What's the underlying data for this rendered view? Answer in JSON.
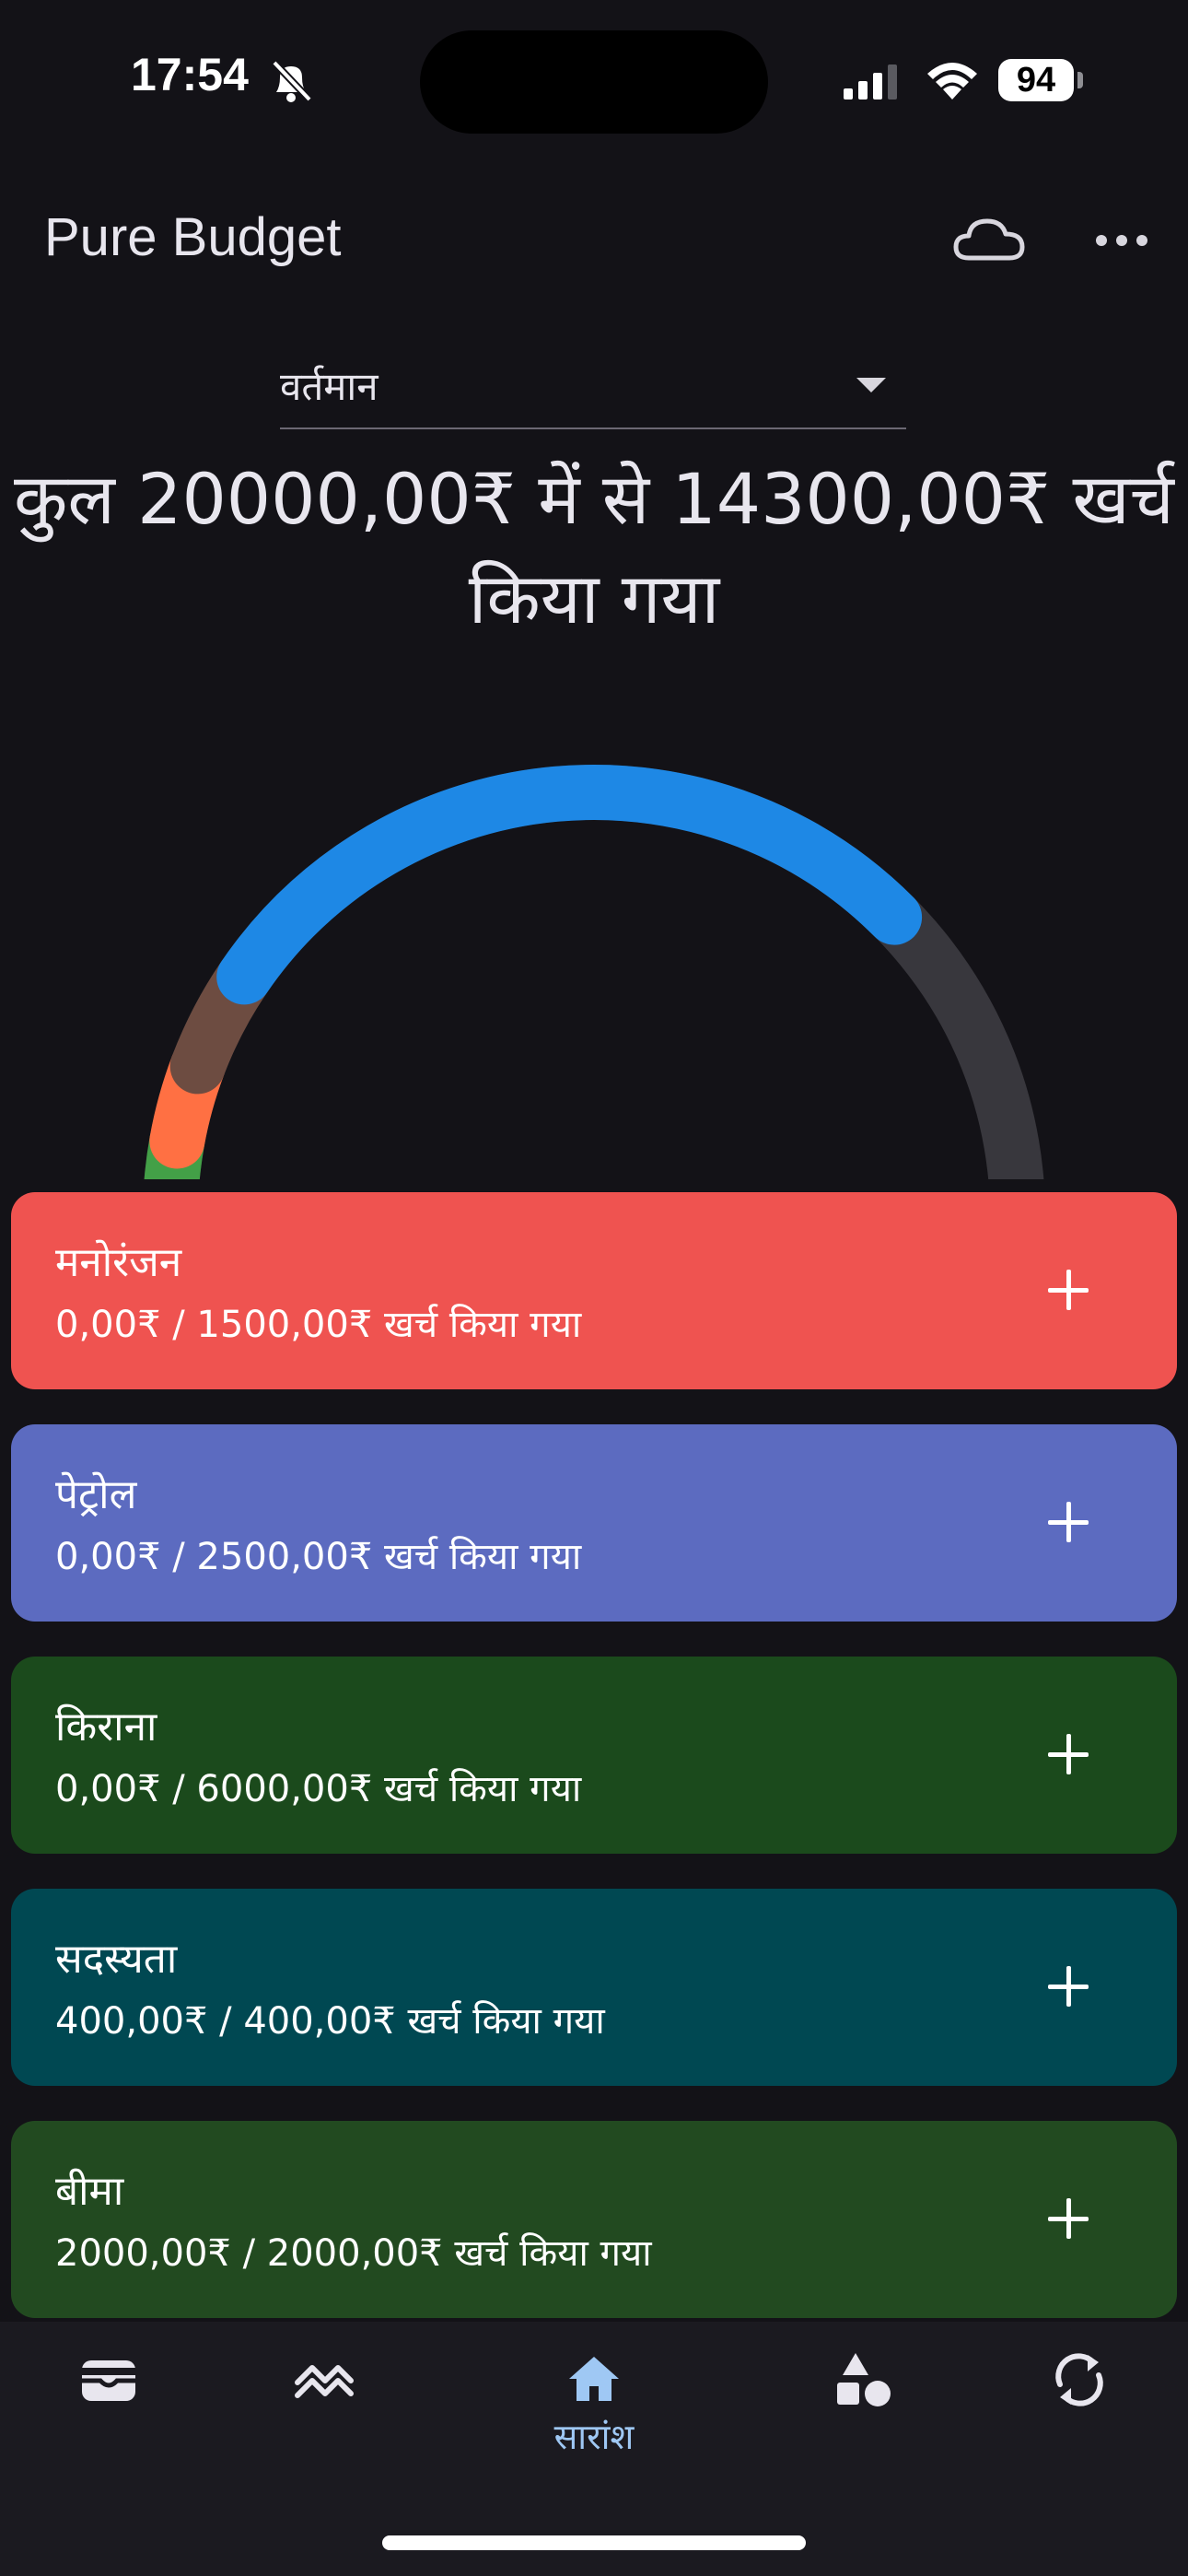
{
  "status_bar": {
    "time": "17:54",
    "battery": "94",
    "icons": [
      "bell-slash-icon",
      "signal-icon",
      "wifi-icon",
      "battery-icon"
    ]
  },
  "app_bar": {
    "title": "Pure Budget",
    "actions": [
      "cloud-icon",
      "more-horizontal-icon"
    ]
  },
  "period": {
    "selected": "वर्तमान"
  },
  "summary": {
    "line1": "कुल 20000,00₹ में से 14300,00₹ खर्च",
    "line2": "किया गया",
    "total": 20000,
    "spent": 14300,
    "track_color": "#38373d"
  },
  "gauge_segments": [
    {
      "label": "सदस्यता",
      "fraction": 0.02,
      "color": "#00919a"
    },
    {
      "label": "बीमा",
      "fraction": 0.1,
      "color": "#43a047"
    },
    {
      "label": "unlabeled-orange",
      "fraction": 0.05,
      "color": "#ff7043"
    },
    {
      "label": "unlabeled-brown",
      "fraction": 0.065,
      "color": "#6d4c41"
    },
    {
      "label": "unlabeled-blue",
      "fraction": 0.48,
      "color": "#1e88e5"
    }
  ],
  "categories": [
    {
      "name": "मनोरंजन",
      "amount": "0,00₹ / 1500,00₹ खर्च किया गया",
      "color": "#ef5350"
    },
    {
      "name": "पेट्रोल",
      "amount": "0,00₹ / 2500,00₹ खर्च किया गया",
      "color": "#5c6bc0"
    },
    {
      "name": "किराना",
      "amount": "0,00₹ / 6000,00₹ खर्च किया गया",
      "color": "#1b4a1c"
    },
    {
      "name": "सदस्यता",
      "amount": "400,00₹ / 400,00₹ खर्च किया गया",
      "color": "#004852"
    },
    {
      "name": "बीमा",
      "amount": "2000,00₹ / 2000,00₹ खर्च किया गया",
      "color": "#224a20"
    }
  ],
  "bottom_nav": {
    "items": [
      {
        "icon": "wallet-icon",
        "label": ""
      },
      {
        "icon": "trend-chart-icon",
        "label": ""
      },
      {
        "icon": "home-icon",
        "label": "सारांश",
        "active": true
      },
      {
        "icon": "shapes-icon",
        "label": ""
      },
      {
        "icon": "refresh-icon",
        "label": ""
      }
    ]
  }
}
